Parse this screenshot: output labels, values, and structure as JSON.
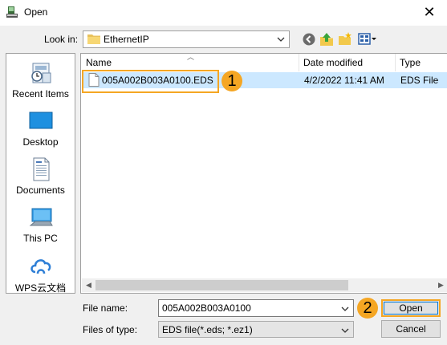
{
  "window": {
    "title": "Open",
    "close_glyph": "✕"
  },
  "lookin": {
    "label": "Look in:",
    "value": "EthernetIP"
  },
  "toolbar": {
    "icons": [
      "back-icon",
      "up-folder-icon",
      "new-folder-icon",
      "view-menu-icon"
    ]
  },
  "places": [
    {
      "label": "Recent Items",
      "icon": "recent-items-icon"
    },
    {
      "label": "Desktop",
      "icon": "desktop-icon"
    },
    {
      "label": "Documents",
      "icon": "documents-icon"
    },
    {
      "label": "This PC",
      "icon": "this-pc-icon"
    },
    {
      "label": "WPS云文档",
      "icon": "wps-cloud-icon"
    }
  ],
  "filelist": {
    "columns": [
      "Name",
      "Date modified",
      "Type"
    ],
    "files": [
      {
        "name": "005A002B003A0100.EDS",
        "date": "4/2/2022 11:41 AM",
        "type": "EDS File"
      }
    ]
  },
  "form": {
    "filename_label": "File name:",
    "filename_value": "005A002B003A0100",
    "filetype_label": "Files of type:",
    "filetype_value": "EDS file(*.eds; *.ez1)"
  },
  "buttons": {
    "open": "Open",
    "cancel": "Cancel"
  },
  "callouts": [
    "1",
    "2"
  ],
  "colors": {
    "accent": "#f5a623",
    "selection": "#cce8ff",
    "focus": "#0078d7"
  }
}
